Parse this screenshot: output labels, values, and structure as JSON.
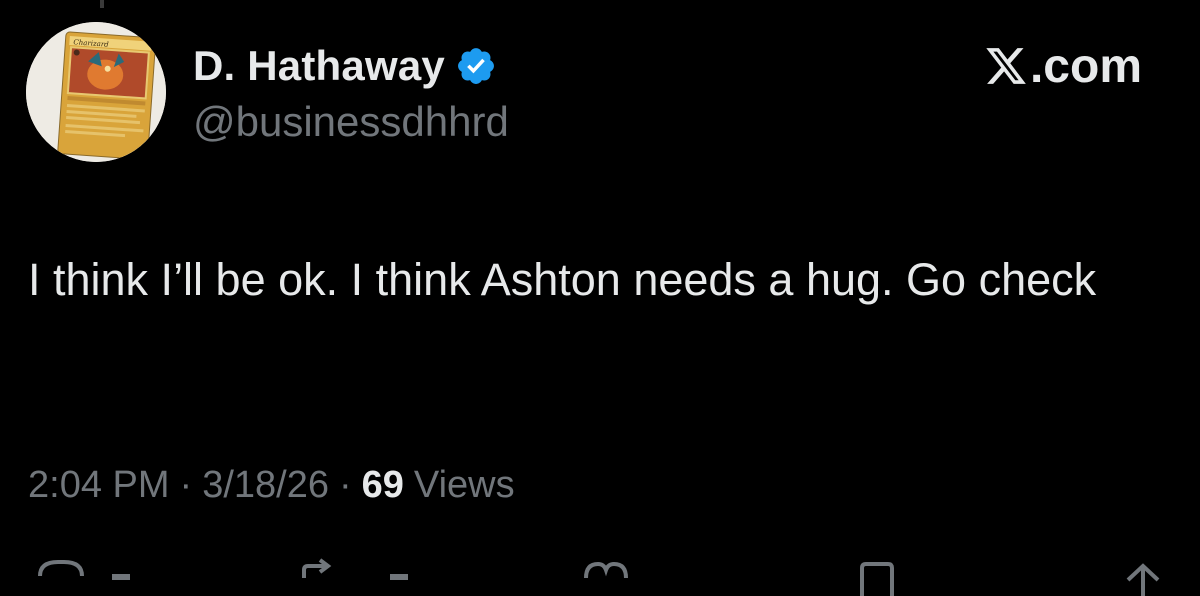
{
  "author": {
    "display_name": "D. Hathaway",
    "handle": "@businessdhhrd",
    "verified": true,
    "verified_color": "#1d9bf0",
    "avatar_icon": "charizard-card-avatar",
    "avatar_card_name": "Charizard"
  },
  "brand": {
    "logo_icon": "x-logo-icon",
    "label": ".com"
  },
  "tweet": {
    "text": "I think I’ll be ok. I think Ashton needs a hug. Go check",
    "time": "2:04 PM",
    "date": "3/18/26",
    "separator": "·",
    "views_count": "69",
    "views_label": "Views"
  },
  "actions": [
    {
      "name": "reply-icon"
    },
    {
      "name": "retweet-icon"
    },
    {
      "name": "like-icon"
    },
    {
      "name": "bookmark-icon"
    },
    {
      "name": "share-icon"
    }
  ],
  "colors": {
    "background": "#000000",
    "text_primary": "#e7e9ea",
    "text_secondary": "#71767b"
  }
}
